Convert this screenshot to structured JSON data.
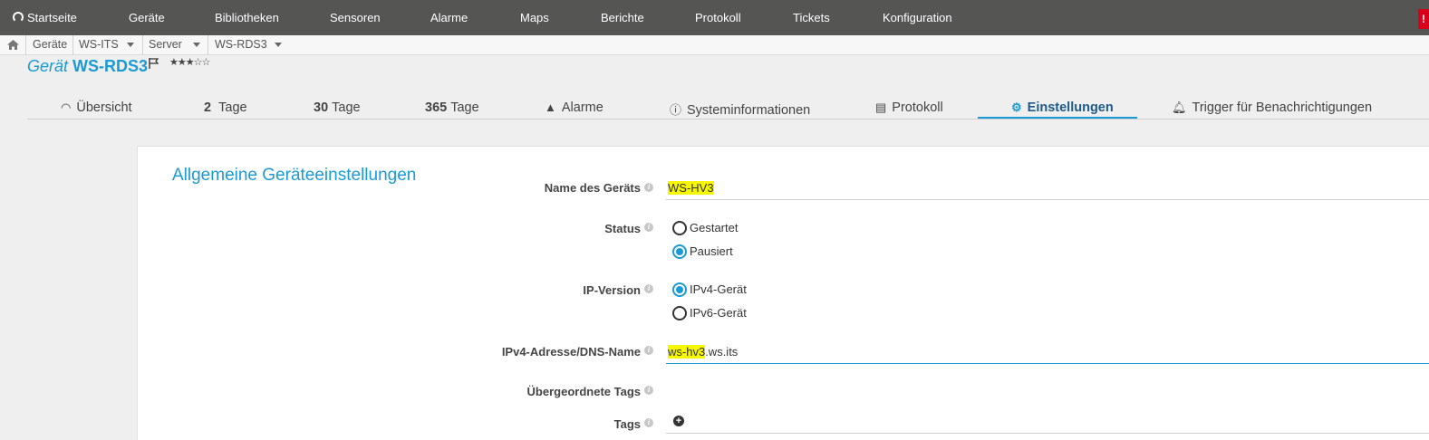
{
  "nav": {
    "items": [
      "Startseite",
      "Geräte",
      "Bibliotheken",
      "Sensoren",
      "Alarme",
      "Maps",
      "Berichte",
      "Protokoll",
      "Tickets",
      "Konfiguration"
    ],
    "alert": "!"
  },
  "breadcrumb": {
    "items": [
      "Geräte",
      "WS-ITS",
      "Server",
      "WS-RDS3"
    ]
  },
  "device": {
    "kind": "Gerät",
    "name": "WS-RDS3",
    "stars": "★★★☆☆"
  },
  "tabs": [
    {
      "num": "",
      "label": "Übersicht"
    },
    {
      "num": "2",
      "label": "Tage"
    },
    {
      "num": "30",
      "label": "Tage"
    },
    {
      "num": "365",
      "label": "Tage"
    },
    {
      "num": "",
      "label": "Alarme"
    },
    {
      "num": "",
      "label": "Systeminformationen"
    },
    {
      "num": "",
      "label": "Protokoll"
    },
    {
      "num": "",
      "label": "Einstellungen"
    },
    {
      "num": "",
      "label": "Trigger für Benachrichtigungen"
    }
  ],
  "settings": {
    "section_title": "Allgemeine Geräteeinstellungen",
    "labels": {
      "name": "Name des Geräts",
      "status": "Status",
      "ip_version": "IP-Version",
      "address": "IPv4-Adresse/DNS-Name",
      "parent_tags": "Übergeordnete Tags",
      "tags": "Tags"
    },
    "name_value": "WS-HV3",
    "status_options": [
      "Gestartet",
      "Pausiert"
    ],
    "status_selected": "Pausiert",
    "ip_options": [
      "IPv4-Gerät",
      "IPv6-Gerät"
    ],
    "ip_selected": "IPv4-Gerät",
    "address_value_highlight": "ws-hv3",
    "address_value_rest": ".ws.its",
    "info_glyph": "i",
    "add_glyph": "+"
  },
  "colors": {
    "accent": "#1a9ad6",
    "nav_bg": "#555554",
    "highlight": "#f7f700",
    "alert": "#d9001b"
  }
}
